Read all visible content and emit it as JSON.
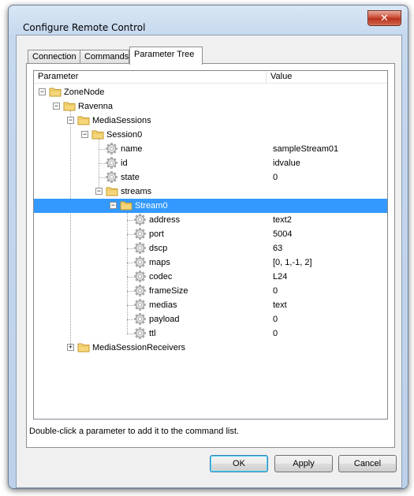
{
  "window": {
    "title": "Configure Remote Control",
    "close_glyph": "✕"
  },
  "tabs": [
    {
      "label": "Connection"
    },
    {
      "label": "Commands"
    },
    {
      "label": "Parameter Tree",
      "active": true
    }
  ],
  "tree": {
    "columns": {
      "parameter": "Parameter",
      "value": "Value"
    },
    "nodes": [
      {
        "label": "ZoneNode",
        "value": "",
        "icon": "folder-icon",
        "expander": "−"
      },
      {
        "label": "Ravenna",
        "value": "",
        "icon": "folder-icon",
        "expander": "−"
      },
      {
        "label": "MediaSessions",
        "value": "",
        "icon": "folder-icon",
        "expander": "−"
      },
      {
        "label": "Session0",
        "value": "",
        "icon": "folder-icon",
        "expander": "−"
      },
      {
        "label": "name",
        "value": "sampleStream01",
        "icon": "gear-icon"
      },
      {
        "label": "id",
        "value": "idvalue",
        "icon": "gear-icon"
      },
      {
        "label": "state",
        "value": "0",
        "icon": "gear-icon"
      },
      {
        "label": "streams",
        "value": "",
        "icon": "folder-icon",
        "expander": "−"
      },
      {
        "label": "Stream0",
        "value": "",
        "icon": "folder-icon",
        "expander": "−",
        "selected": true
      },
      {
        "label": "address",
        "value": "text2",
        "icon": "gear-icon"
      },
      {
        "label": "port",
        "value": "5004",
        "icon": "gear-icon"
      },
      {
        "label": "dscp",
        "value": "63",
        "icon": "gear-icon"
      },
      {
        "label": "maps",
        "value": "[0, 1,-1,  2]",
        "icon": "gear-icon"
      },
      {
        "label": "codec",
        "value": "L24",
        "icon": "gear-icon"
      },
      {
        "label": "frameSize",
        "value": "0",
        "icon": "gear-icon"
      },
      {
        "label": "medias",
        "value": "text",
        "icon": "gear-icon"
      },
      {
        "label": "payload",
        "value": "0",
        "icon": "gear-icon"
      },
      {
        "label": "ttl",
        "value": "0",
        "icon": "gear-icon"
      },
      {
        "label": "MediaSessionReceivers",
        "value": "",
        "icon": "folder-icon",
        "expander": "+"
      }
    ]
  },
  "status_text": "Double-click a parameter to add it to the command list.",
  "buttons": {
    "ok": "OK",
    "apply": "Apply",
    "cancel": "Cancel"
  },
  "colors": {
    "selection": "#3399ff",
    "folder": "#f5d67a",
    "title_bar": "#c5d8ee"
  }
}
